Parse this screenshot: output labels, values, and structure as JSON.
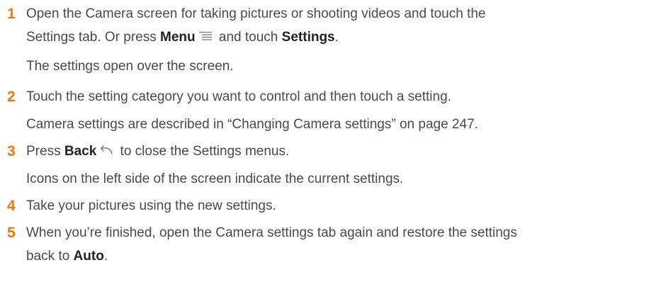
{
  "steps": [
    {
      "number": "1",
      "line1": "Open the Camera screen for taking pictures or shooting videos and touch the",
      "line2_pre": "Settings tab. Or press ",
      "line2_bold1": "Menu",
      "line2_mid": " and touch ",
      "line2_bold2": "Settings",
      "line2_post": ".",
      "note": "The settings open over the screen."
    },
    {
      "number": "2",
      "line1": "Touch the setting category you want to control and then touch a setting.",
      "note": "Camera settings are described in “Changing Camera settings” on page 247."
    },
    {
      "number": "3",
      "line1_pre": "Press ",
      "line1_bold": "Back",
      "line1_post": " to close the Settings menus.",
      "note": "Icons on the left side of the screen indicate the current settings."
    },
    {
      "number": "4",
      "line1": "Take your pictures using the new settings."
    },
    {
      "number": "5",
      "line1": "When you’re finished, open the Camera settings tab again and restore the settings",
      "line2_pre": "back to ",
      "line2_bold": "Auto",
      "line2_post": "."
    }
  ],
  "icons": {
    "menu": "menu-icon",
    "back": "back-icon"
  },
  "colors": {
    "step_number": "#ff7200",
    "body_text": "#4a4a4a"
  }
}
